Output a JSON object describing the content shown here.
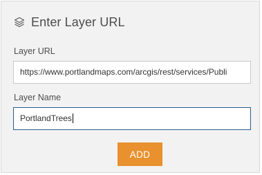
{
  "dialog": {
    "title": "Enter Layer URL",
    "icon": "layers-icon"
  },
  "form": {
    "url_label": "Layer URL",
    "url_value": "https://www.portlandmaps.com/arcgis/rest/services/Publi",
    "name_label": "Layer Name",
    "name_value": "PortlandTrees"
  },
  "actions": {
    "add_label": "ADD"
  },
  "colors": {
    "accent": "#e8912e",
    "focus_border": "#2f5b89",
    "panel_bg": "#f2f2f2"
  }
}
